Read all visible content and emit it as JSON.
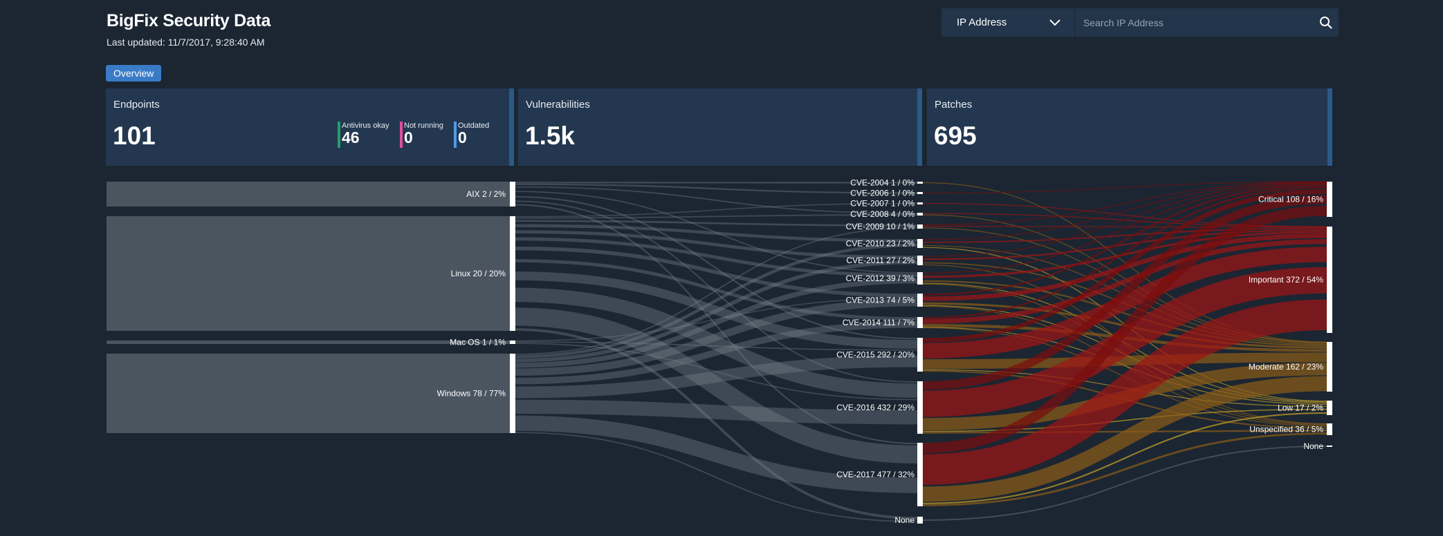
{
  "header": {
    "title": "BigFix Security Data",
    "updated": "Last updated: 11/7/2017, 9:28:40 AM"
  },
  "search": {
    "field": "IP Address",
    "placeholder": "Search IP Address"
  },
  "tabs": [
    {
      "label": "Overview"
    }
  ],
  "cards": {
    "endpoints": {
      "label": "Endpoints",
      "value": "101",
      "stats": [
        {
          "label": "Antivirus okay",
          "value": "46",
          "color": "#22a06b"
        },
        {
          "label": "Not running",
          "value": "0",
          "color": "#e04f9b"
        },
        {
          "label": "Outdated",
          "value": "0",
          "color": "#4a9ee8"
        }
      ]
    },
    "vulnerabilities": {
      "label": "Vulnerabilities",
      "value": "1.5k"
    },
    "patches": {
      "label": "Patches",
      "value": "695"
    }
  },
  "colors": {
    "critical": "#7a0d0d",
    "important": "#a01414",
    "moderate": "#8b5c17",
    "low": "#c9a227",
    "neutral_link": "#56606b"
  },
  "sankey": {
    "os": [
      {
        "id": "aix",
        "label": "AIX 2 / 2%",
        "value": 2
      },
      {
        "id": "linux",
        "label": "Linux 20 / 20%",
        "value": 20
      },
      {
        "id": "mac",
        "label": "Mac OS 1 / 1%",
        "value": 1
      },
      {
        "id": "windows",
        "label": "Windows 78 / 77%",
        "value": 78
      }
    ],
    "cve": [
      {
        "id": "c2004",
        "label": "CVE-2004 1 / 0%",
        "value": 1
      },
      {
        "id": "c2006",
        "label": "CVE-2006 1 / 0%",
        "value": 1
      },
      {
        "id": "c2007",
        "label": "CVE-2007 1 / 0%",
        "value": 1
      },
      {
        "id": "c2008",
        "label": "CVE-2008 4 / 0%",
        "value": 4
      },
      {
        "id": "c2009",
        "label": "CVE-2009 10 / 1%",
        "value": 10
      },
      {
        "id": "c2010",
        "label": "CVE-2010 23 / 2%",
        "value": 23
      },
      {
        "id": "c2011",
        "label": "CVE-2011 27 / 2%",
        "value": 27
      },
      {
        "id": "c2012",
        "label": "CVE-2012 39 / 3%",
        "value": 39
      },
      {
        "id": "c2013",
        "label": "CVE-2013 74 / 5%",
        "value": 74
      },
      {
        "id": "c2014",
        "label": "CVE-2014 111 / 7%",
        "value": 111
      },
      {
        "id": "c2015",
        "label": "CVE-2015 292 / 20%",
        "value": 292
      },
      {
        "id": "c2016",
        "label": "CVE-2016 432 / 29%",
        "value": 432
      },
      {
        "id": "c2017",
        "label": "CVE-2017 477 / 32%",
        "value": 477
      },
      {
        "id": "cnone",
        "label": "None",
        "value": 0
      }
    ],
    "severity": [
      {
        "id": "critical",
        "label": "Critical 108 / 16%",
        "value": 108
      },
      {
        "id": "important",
        "label": "Important 372 / 54%",
        "value": 372
      },
      {
        "id": "moderate",
        "label": "Moderate 162 / 23%",
        "value": 162
      },
      {
        "id": "low",
        "label": "Low 17 / 2%",
        "value": 17
      },
      {
        "id": "unspecified",
        "label": "Unspecified 36 / 5%",
        "value": 36
      },
      {
        "id": "snone",
        "label": "None",
        "value": 0
      }
    ]
  }
}
